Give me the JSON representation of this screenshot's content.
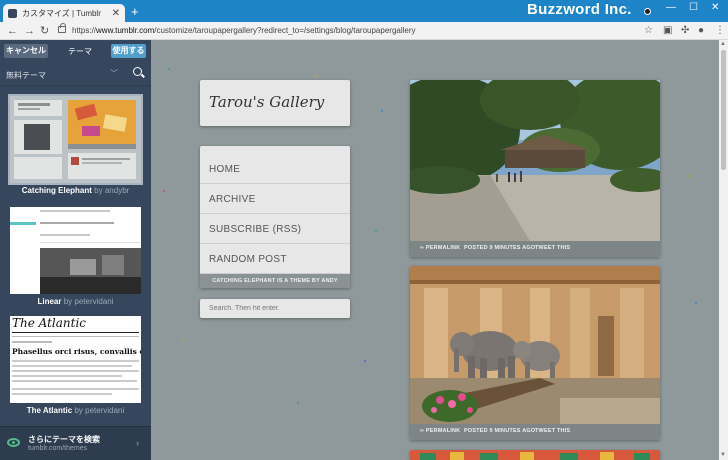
{
  "browser": {
    "tab_title": "カスタマイズ | Tumblr",
    "new_tab": "+",
    "brand": "Buzzword Inc.",
    "url_prefix": "https://",
    "url_host": "www.tumblr.com",
    "url_path": "/customize/taroupapergallery?redirect_to=/settings/blog/taroupapergallery",
    "icons": [
      "back-icon",
      "forward-icon",
      "reload-icon",
      "lock-icon",
      "star-icon",
      "extensions-icon",
      "profile-icon",
      "menu-icon"
    ]
  },
  "panel": {
    "cancel_label": "キャンセル",
    "title": "テーマ",
    "use_label": "使用する",
    "filter_label": "無料テーマ",
    "themes": [
      {
        "name": "Catching Elephant",
        "by": "by",
        "author": "andybr"
      },
      {
        "name": "Linear",
        "by": "by",
        "author": "petervidani"
      },
      {
        "name": "The Atlantic",
        "by": "by",
        "author": "petervidani"
      }
    ],
    "atlantic_thumb_title": "The Atlantic",
    "atlantic_thumb_heading": "Phasellus orci risus, convallis eu",
    "footer_title": "さらにテーマを検索",
    "footer_sub": "tumblr.com/themes"
  },
  "preview": {
    "blog_title": "Tarou's Gallery",
    "menu": [
      "HOME",
      "ARCHIVE",
      "SUBSCRIBE (RSS)",
      "RANDOM POST"
    ],
    "credit": "CATCHING ELEPHANT IS A THEME BY ANDY TAYLOR",
    "search_placeholder": "Search. Then hit enter.",
    "posts": [
      {
        "permalink": "∞ PERMALINK",
        "posted": "POSTED 9 MINUTES AGO",
        "tweet": "TWEET THIS"
      },
      {
        "permalink": "∞ PERMALINK",
        "posted": "POSTED 9 MINUTES AGO",
        "tweet": "TWEET THIS"
      }
    ]
  },
  "colors": {
    "titlebar": "#1e84c8",
    "panel": "#36465d",
    "accent_button": "#529ecc",
    "preview_bg": "#8f999b"
  }
}
